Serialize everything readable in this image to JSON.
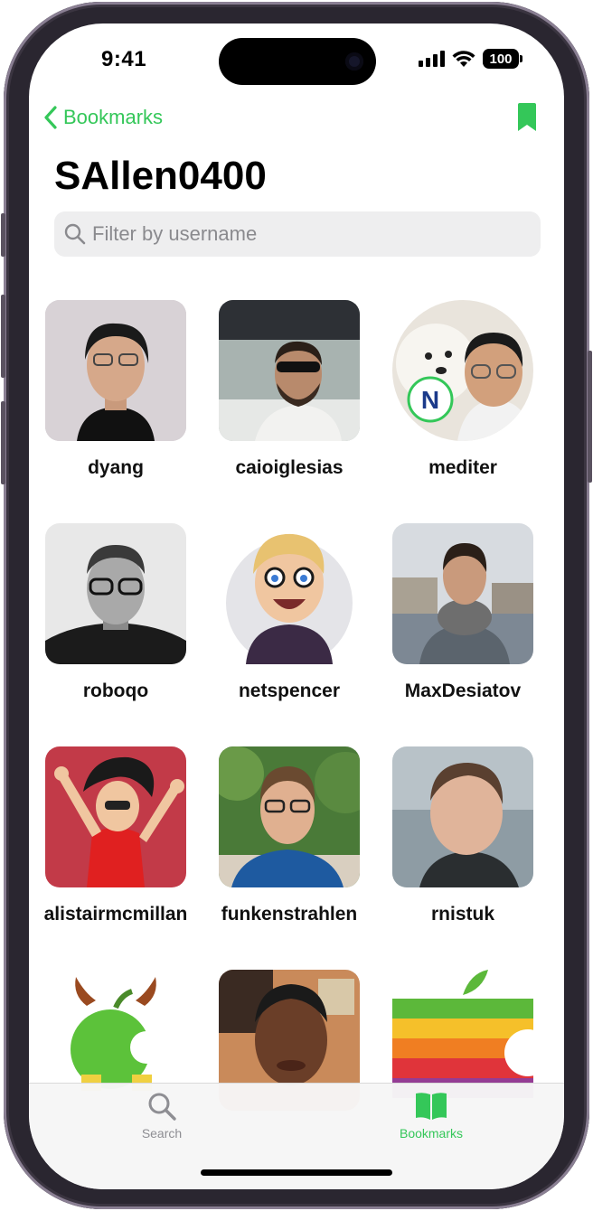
{
  "status": {
    "time": "9:41",
    "battery": "100"
  },
  "nav": {
    "back_label": "Bookmarks"
  },
  "page": {
    "title": "SAllen0400"
  },
  "search": {
    "placeholder": "Filter by username"
  },
  "users": [
    {
      "username": "dyang"
    },
    {
      "username": "caioiglesias"
    },
    {
      "username": "mediter"
    },
    {
      "username": "roboqo"
    },
    {
      "username": "netspencer"
    },
    {
      "username": "MaxDesiatov"
    },
    {
      "username": "alistairmcmillan"
    },
    {
      "username": "funkenstrahlen"
    },
    {
      "username": "rnistuk"
    }
  ],
  "tabs": [
    {
      "label": "Search",
      "icon": "magnifier-icon",
      "active": false
    },
    {
      "label": "Bookmarks",
      "icon": "book-icon",
      "active": true
    }
  ],
  "colors": {
    "accent": "#34c759",
    "inactive": "#8e8e93"
  }
}
